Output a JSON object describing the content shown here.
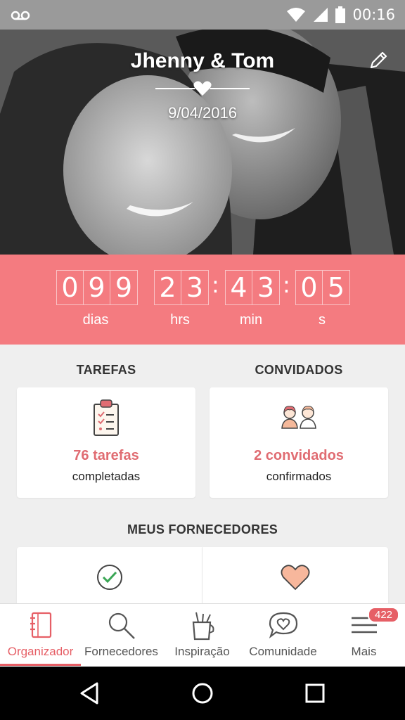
{
  "status_bar": {
    "time": "00:16"
  },
  "hero": {
    "title": "Jhenny & Tom",
    "date": "9/04/2016"
  },
  "countdown": {
    "days": [
      "0",
      "9",
      "9"
    ],
    "hours": [
      "2",
      "3"
    ],
    "minutes": [
      "4",
      "3"
    ],
    "seconds": [
      "0",
      "5"
    ],
    "labels": {
      "days": "dias",
      "hours": "hrs",
      "minutes": "min",
      "seconds": "s"
    }
  },
  "tasks": {
    "title": "TAREFAS",
    "count": "76 tarefas",
    "subtitle": "completadas"
  },
  "guests": {
    "title": "CONVIDADOS",
    "count": "2 convidados",
    "subtitle": "confirmados"
  },
  "vendors": {
    "title": "MEUS FORNECEDORES"
  },
  "bottom_nav": [
    {
      "label": "Organizador",
      "icon": "notebook-icon",
      "active": true
    },
    {
      "label": "Fornecedores",
      "icon": "search-icon"
    },
    {
      "label": "Inspiração",
      "icon": "pencil-cup-icon"
    },
    {
      "label": "Comunidade",
      "icon": "chat-heart-icon"
    },
    {
      "label": "Mais",
      "icon": "menu-icon",
      "badge": "422"
    }
  ],
  "colors": {
    "accent": "#f47b80",
    "accent_dark": "#e65f66",
    "background": "#efefef"
  }
}
